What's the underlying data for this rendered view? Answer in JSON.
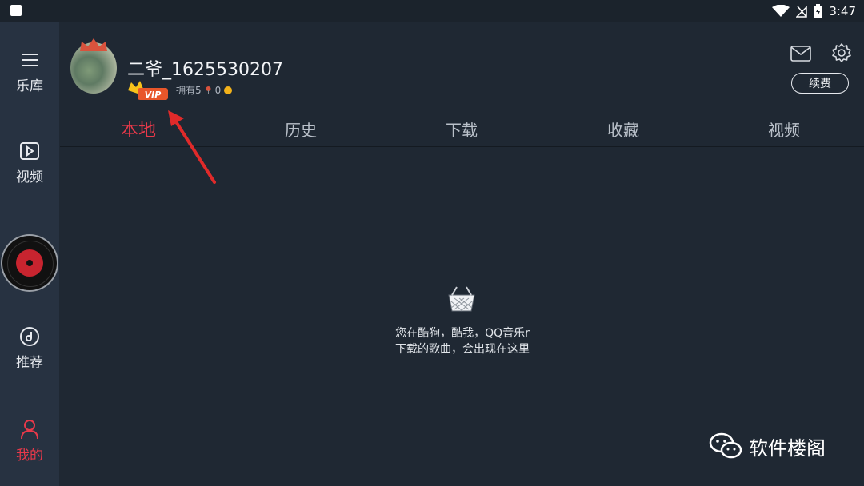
{
  "status_bar": {
    "time": "3:47",
    "icons": [
      "app-square-icon",
      "wifi-icon",
      "no-signal-icon",
      "battery-icon"
    ]
  },
  "sidebar": {
    "items": [
      {
        "label": "乐库",
        "icon": "menu-icon"
      },
      {
        "label": "视频",
        "icon": "video-icon"
      },
      {
        "label": "推荐",
        "icon": "music-disc-icon"
      },
      {
        "label": "我的",
        "icon": "user-icon",
        "active": true
      }
    ],
    "now_playing_icon": "vinyl-disc-icon"
  },
  "profile": {
    "username": "二爷_1625530207",
    "vip_label": "VIP",
    "owns_prefix": "拥有5",
    "coins": "0",
    "renew_label": "续费",
    "icons": [
      "mail-icon",
      "gear-icon"
    ]
  },
  "tabs": [
    {
      "label": "本地",
      "active": true
    },
    {
      "label": "历史"
    },
    {
      "label": "下载"
    },
    {
      "label": "收藏"
    },
    {
      "label": "视频"
    }
  ],
  "empty_state": {
    "line1": "您在酷狗，酷我，QQ音乐r",
    "line2": "下载的歌曲，会出现在这里",
    "icon": "basket-icon"
  },
  "watermark": {
    "text": "软件楼阁",
    "icon": "wechat-icon"
  },
  "colors": {
    "accent": "#e8394a",
    "background": "#1f2833",
    "sidebar": "#273241"
  }
}
